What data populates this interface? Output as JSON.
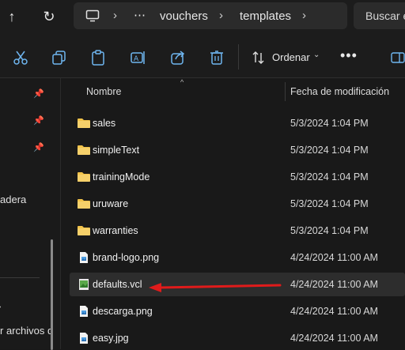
{
  "address": {
    "overflow": "⋯",
    "crumbs": [
      "vouchers",
      "templates"
    ],
    "search_placeholder": "Buscar en templates"
  },
  "toolbar": {
    "sort_label": "Ordenar",
    "more_label": "•••"
  },
  "nav": {
    "items": [
      "adera",
      "r archivos d"
    ]
  },
  "columns": {
    "name": "Nombre",
    "date": "Fecha de modificación"
  },
  "files": [
    {
      "name": "sales",
      "date": "5/3/2024 1:04 PM",
      "icon": "folder-icon"
    },
    {
      "name": "simpleText",
      "date": "5/3/2024 1:04 PM",
      "icon": "folder-icon"
    },
    {
      "name": "trainingMode",
      "date": "5/3/2024 1:04 PM",
      "icon": "folder-icon"
    },
    {
      "name": "uruware",
      "date": "5/3/2024 1:04 PM",
      "icon": "folder-icon"
    },
    {
      "name": "warranties",
      "date": "5/3/2024 1:04 PM",
      "icon": "folder-icon"
    },
    {
      "name": "brand-logo.png",
      "date": "4/24/2024 11:00 AM",
      "icon": "image-file-icon"
    },
    {
      "name": "defaults.vcl",
      "date": "4/24/2024 11:00 AM",
      "icon": "vcl-file-icon",
      "selected": true
    },
    {
      "name": "descarga.png",
      "date": "4/24/2024 11:00 AM",
      "icon": "image-file-icon"
    },
    {
      "name": "easy.jpg",
      "date": "4/24/2024 11:00 AM",
      "icon": "image-file-icon"
    }
  ],
  "colors": {
    "background": "#191919",
    "folder": "#f2c34a",
    "image_file": "#4d9de0",
    "annotation_arrow": "#e01b1b"
  }
}
